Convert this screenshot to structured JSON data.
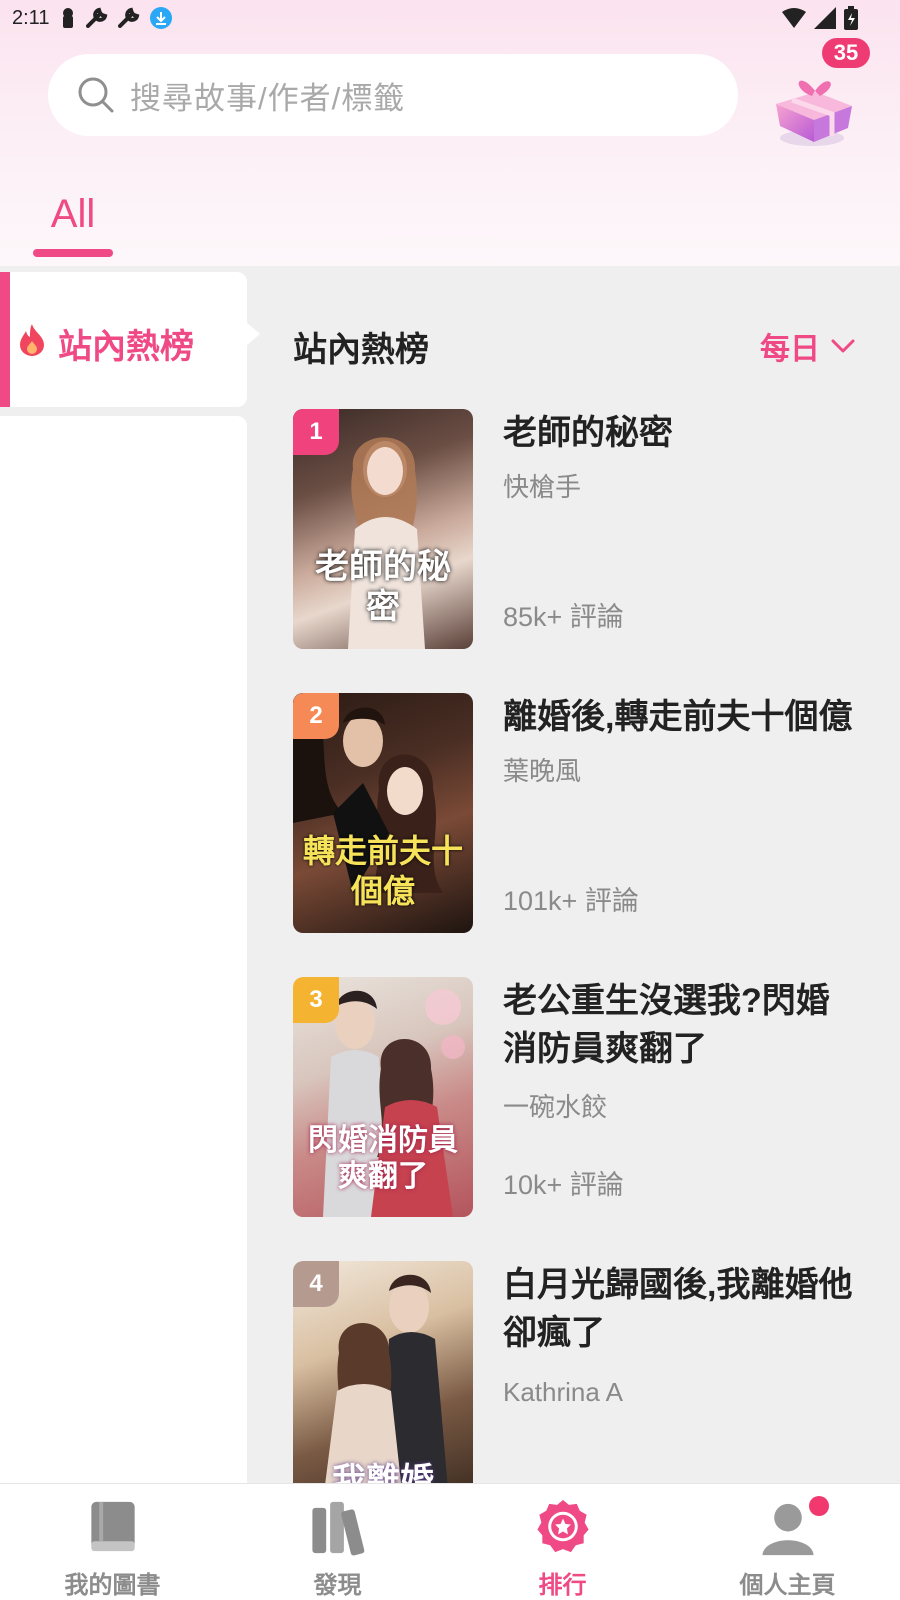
{
  "status_bar": {
    "time": "2:11"
  },
  "search": {
    "placeholder": "搜尋故事/作者/標籤",
    "icon": "search-icon"
  },
  "gift": {
    "badge_count": "35",
    "icon": "gift-icon"
  },
  "tabs": [
    {
      "label": "All",
      "active": true
    }
  ],
  "categories": [
    {
      "label": "站內熱榜",
      "icon": "fire-icon",
      "active": true
    }
  ],
  "section": {
    "title": "站內熱榜",
    "period_label": "每日"
  },
  "books": [
    {
      "rank": "1",
      "title": "老師的秘密",
      "author": "快槍手",
      "reviews": "85k+ 評論",
      "cover_text": "老師的秘密"
    },
    {
      "rank": "2",
      "title": "離婚後,轉走前夫十個億",
      "author": "葉晚風",
      "reviews": "101k+ 評論",
      "cover_text": "轉走前夫十個億"
    },
    {
      "rank": "3",
      "title": "老公重生沒選我?閃婚消防員爽翻了",
      "author": "一碗水餃",
      "reviews": "10k+ 評論",
      "cover_text": "閃婚消防員爽翻了"
    },
    {
      "rank": "4",
      "title": "白月光歸國後,我離婚他卻瘋了",
      "author": "Kathrina A",
      "reviews": "",
      "cover_text": "我離婚"
    }
  ],
  "bottom_nav": [
    {
      "label": "我的圖書",
      "icon": "book-icon",
      "active": false
    },
    {
      "label": "發現",
      "icon": "books-shelf-icon",
      "active": false
    },
    {
      "label": "排行",
      "icon": "ranking-badge-icon",
      "active": true
    },
    {
      "label": "個人主頁",
      "icon": "user-icon",
      "active": false,
      "has_dot": true
    }
  ],
  "colors": {
    "accent": "#ef4a85",
    "badge": "#ef3b73",
    "rank1": "#f0427d",
    "rank2": "#f58a57",
    "rank3": "#f4b331",
    "rank4": "#b59b8f"
  }
}
